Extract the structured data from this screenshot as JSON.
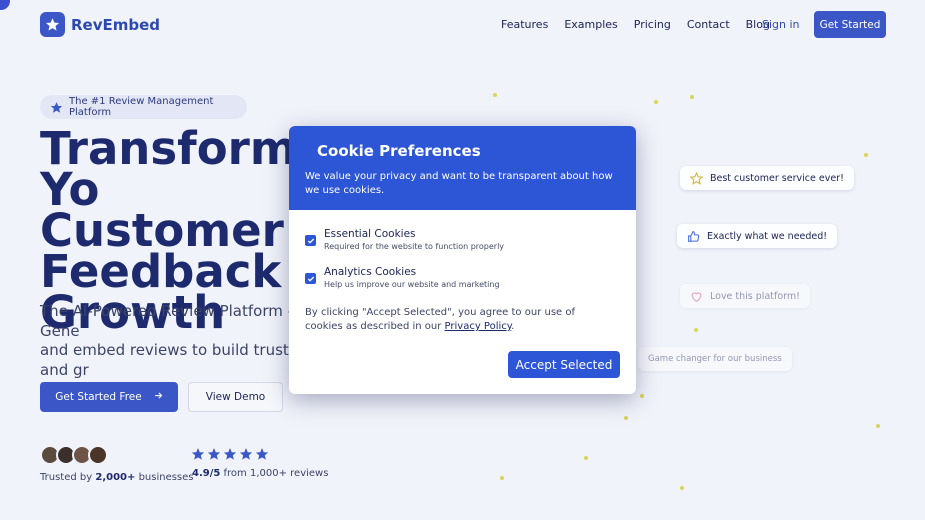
{
  "header": {
    "brand": "RevEmbed",
    "nav": [
      "Features",
      "Examples",
      "Pricing",
      "Contact",
      "Blog"
    ],
    "sign_in": "Sign in",
    "get_started": "Get Started"
  },
  "hero": {
    "badge": "The #1 Review Management Platform",
    "title": "Transform Yo\nCustomer\nFeedback Int\nGrowth",
    "subtitle": "The AI-Powered Review Platform – Gene\nand embed reviews to build trust and gr\nbusiness.",
    "primary_cta": "Get Started Free",
    "secondary_cta": "View Demo",
    "trusted_prefix": "Trusted by",
    "trusted_count": "2,000+",
    "trusted_suffix": "businesses",
    "rating_value": "4.9/5",
    "rating_text": "from 1,000+ reviews",
    "stars": 5
  },
  "review_cards": [
    {
      "text": "Best customer service ever!",
      "icon": "star-outline-icon"
    },
    {
      "text": "Exactly what we needed!",
      "icon": "thumbs-up-icon"
    },
    {
      "text": "Love this platform!",
      "icon": "heart-icon"
    },
    {
      "text": "Game changer for our business",
      "icon": ""
    }
  ],
  "cookie_modal": {
    "title": "Cookie Preferences",
    "description": "We value your privacy and want to be transparent about how we use cookies.",
    "options": [
      {
        "title": "Essential Cookies",
        "subtitle": "Required for the website to function properly",
        "checked": true
      },
      {
        "title": "Analytics Cookies",
        "subtitle": "Help us improve our website and marketing",
        "checked": true
      }
    ],
    "consent_text": "By clicking \"Accept Selected\", you agree to our use of cookies as described in our ",
    "privacy_link": "Privacy Policy",
    "consent_end": ".",
    "accept_button": "Accept Selected"
  },
  "colors": {
    "brand": "#3b57c7",
    "modal_header": "#2d56d6",
    "heading": "#1d2a6e",
    "star": "#3b57c7",
    "page_bg": "#f1f3fa"
  }
}
